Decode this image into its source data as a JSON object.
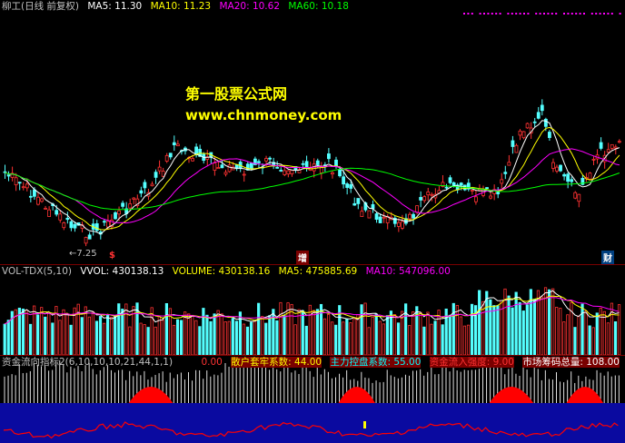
{
  "main": {
    "stock_name": "柳工(日线 前复权)",
    "ma5": "MA5: 11.30",
    "ma10": "MA10: 11.23",
    "ma20": "MA20: 10.62",
    "ma60": "MA60: 10.18",
    "low_label": "←7.25",
    "markers": [
      "$",
      "增",
      "财"
    ],
    "watermark_title": "第一股票公式网",
    "watermark_url": "www.chnmoney.com"
  },
  "volume": {
    "name": "VOL-TDX(5,10)",
    "vvol": "VVOL: 430138.13",
    "volume": "VOLUME: 430138.16",
    "ma5": "MA5: 475885.69",
    "ma10": "MA10: 547096.00"
  },
  "flow": {
    "name": "资金流向指标2(6,10,10,10,21,44,1,1)",
    "v0": "0.00",
    "retail": "散户套牢系数: 44.00",
    "control": "主力控盘系数: 55.00",
    "inflow": "资金流入强度: 9.00",
    "chips": "市场筹码总量: 108.00"
  },
  "colors": {
    "up": "#ff3232",
    "down": "#54ffff",
    "ma5": "#ffffff",
    "ma10": "#ffff00",
    "ma20": "#ff00ff",
    "ma60": "#00ff00",
    "flow_blue": "#0a0aa0",
    "flow_red": "#ff0000",
    "flow_white": "#e0e0e0"
  }
}
